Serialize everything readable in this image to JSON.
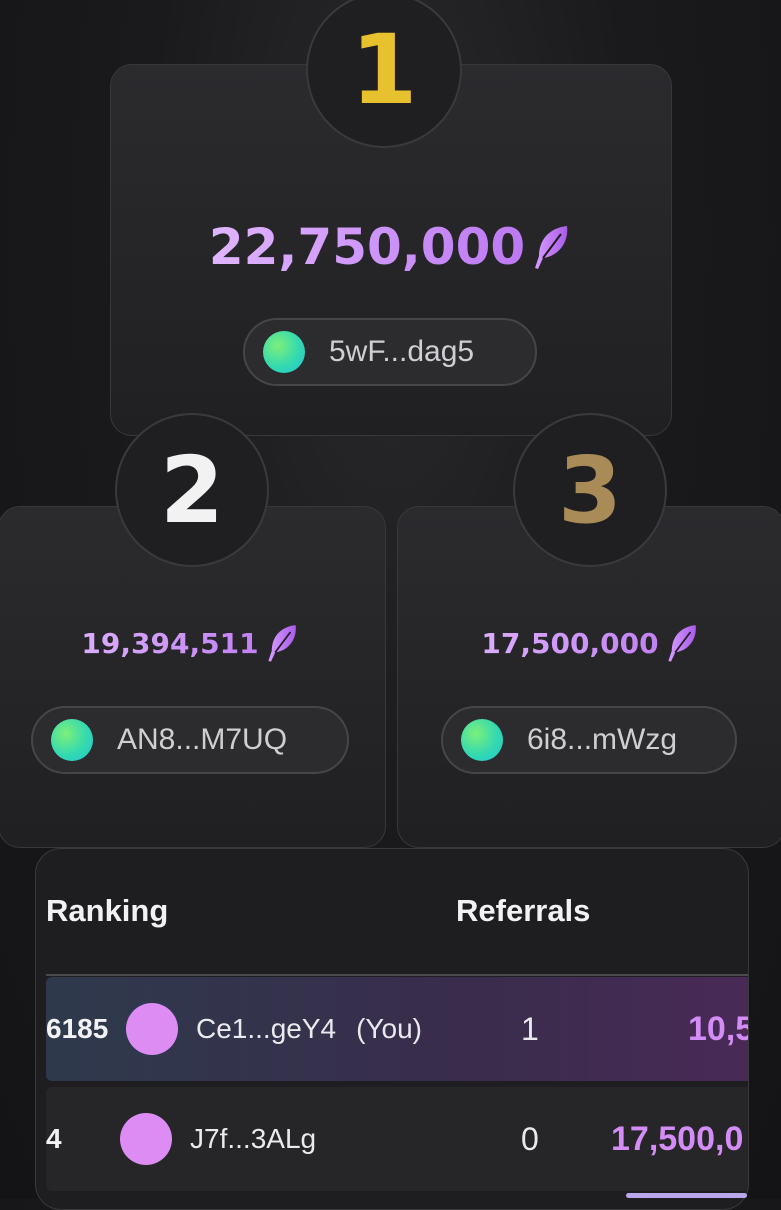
{
  "podium": [
    {
      "rank": "1",
      "score": "22,750,000",
      "address": "5wF...dag5",
      "rank_color": "#e8c12f"
    },
    {
      "rank": "2",
      "score": "19,394,511",
      "address": "AN8...M7UQ",
      "rank_color": "#f2f2f2"
    },
    {
      "rank": "3",
      "score": "17,500,000",
      "address": "6i8...mWzg",
      "rank_color": "#a98b58"
    }
  ],
  "table": {
    "headers": {
      "ranking": "Ranking",
      "referrals": "Referrals"
    },
    "rows": [
      {
        "rank": "6185",
        "address": "Ce1...geY4",
        "you": "(You)",
        "referrals": "1",
        "points": "10,5"
      },
      {
        "rank": "4",
        "address": "J7f...3ALg",
        "you": "",
        "referrals": "0",
        "points": "17,500,0"
      }
    ]
  },
  "colors": {
    "accent": "#c47cf2",
    "avatar": "#dd8cf4",
    "rank1": "#e8c12f",
    "rank3": "#a98b58"
  },
  "icons": {
    "score": "feather-icon"
  }
}
